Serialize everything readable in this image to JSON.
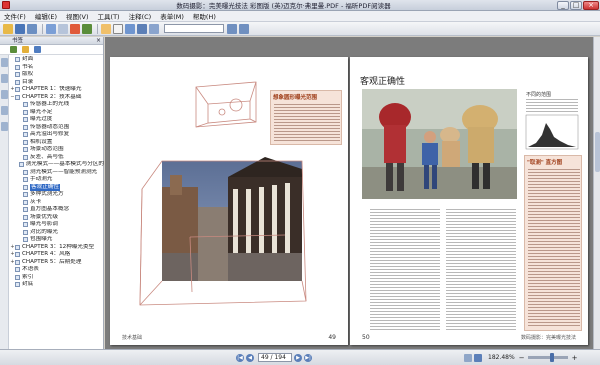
{
  "window": {
    "title": "数码摄影：完美曝光技法 彩图版 (英)迈克尔·弗里曼.PDF - 福昕PDF阅读器"
  },
  "menu": [
    "文件(F)",
    "编辑(E)",
    "视图(V)",
    "工具(T)",
    "注释(C)",
    "表单(M)",
    "帮助(H)"
  ],
  "panel": {
    "title": "书签"
  },
  "bookmarks": [
    {
      "label": "封面",
      "level": 1,
      "expander": ""
    },
    {
      "label": "书名",
      "level": 1,
      "expander": ""
    },
    {
      "label": "版权",
      "level": 1,
      "expander": ""
    },
    {
      "label": "目录",
      "level": 1,
      "expander": ""
    },
    {
      "label": "CHAPTER 1：快速曝光",
      "level": 1,
      "expander": "+"
    },
    {
      "label": "CHAPTER 2：技术基础",
      "level": 1,
      "expander": "−"
    },
    {
      "label": "传感器上的光线",
      "level": 2,
      "expander": ""
    },
    {
      "label": "曝光不足",
      "level": 2,
      "expander": ""
    },
    {
      "label": "曝光过度",
      "level": 2,
      "expander": ""
    },
    {
      "label": "传感器动态范围",
      "level": 2,
      "expander": ""
    },
    {
      "label": "高光溢出与修复",
      "level": 2,
      "expander": ""
    },
    {
      "label": "相机设置",
      "level": 2,
      "expander": ""
    },
    {
      "label": "场景动态范围",
      "level": 2,
      "expander": ""
    },
    {
      "label": "反差、高与低",
      "level": 2,
      "expander": ""
    },
    {
      "label": "测光模式——基本模式与分区的",
      "level": 2,
      "expander": ""
    },
    {
      "label": "测光模式——智能预测测光",
      "level": 2,
      "expander": ""
    },
    {
      "label": "手动测光",
      "level": 2,
      "expander": ""
    },
    {
      "label": "客观正确性",
      "level": 2,
      "expander": "",
      "selected": true
    },
    {
      "label": "多种式测光方",
      "level": 2,
      "expander": ""
    },
    {
      "label": "灰卡",
      "level": 2,
      "expander": ""
    },
    {
      "label": "直方图基本概念",
      "level": 2,
      "expander": ""
    },
    {
      "label": "场景优先级",
      "level": 2,
      "expander": ""
    },
    {
      "label": "曝光与影调",
      "level": 2,
      "expander": ""
    },
    {
      "label": "对比的曝光",
      "level": 2,
      "expander": ""
    },
    {
      "label": "包围曝光",
      "level": 2,
      "expander": ""
    },
    {
      "label": "CHAPTER 3：12种曝光类型",
      "level": 1,
      "expander": "+"
    },
    {
      "label": "CHAPTER 4：风格",
      "level": 1,
      "expander": "+"
    },
    {
      "label": "CHAPTER 5：后期处理",
      "level": 1,
      "expander": "+"
    },
    {
      "label": "术语表",
      "level": 1,
      "expander": ""
    },
    {
      "label": "索引",
      "level": 1,
      "expander": ""
    },
    {
      "label": "封底",
      "level": 1,
      "expander": ""
    }
  ],
  "left_page": {
    "note_title": "想象圆形曝光范围",
    "footer": "技术基础",
    "page_number": "49"
  },
  "right_page": {
    "section_title": "客观正确性",
    "side_title": "不同的范围",
    "tip_title": "\"取测\" 直方图",
    "page_number": "50",
    "footer": "数码摄影：完美曝光技法"
  },
  "status": {
    "page_field": "49 / 194",
    "zoom": "182.48%"
  }
}
